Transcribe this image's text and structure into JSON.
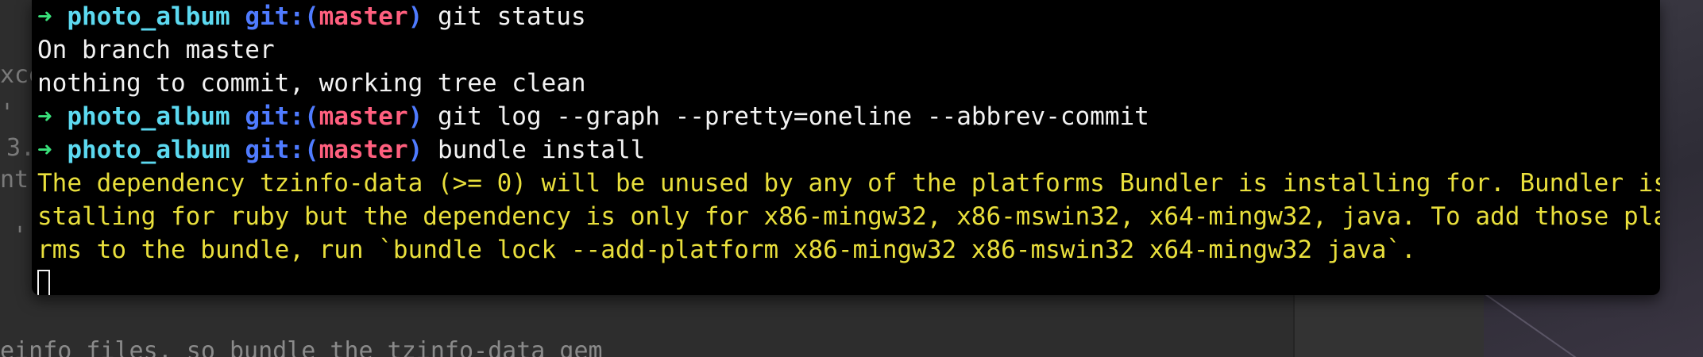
{
  "background": {
    "fragments": [
      "xce",
      "'",
      "3.",
      "nt",
      "'."
    ],
    "bottom_text": "einfo files, so bundle the tzinfo-data gem"
  },
  "terminal": {
    "prompt_arrow": "➜",
    "prompt_dir": "photo_album",
    "prompt_git_prefix": "git:(",
    "prompt_branch": "master",
    "prompt_git_suffix": ")",
    "lines": [
      {
        "type": "prompt",
        "command": "git status"
      },
      {
        "type": "output",
        "text": "On branch master"
      },
      {
        "type": "output",
        "text": "nothing to commit, working tree clean"
      },
      {
        "type": "prompt",
        "command": "git log --graph --pretty=oneline --abbrev-commit"
      },
      {
        "type": "prompt",
        "command": "bundle install"
      },
      {
        "type": "warning",
        "text": "The dependency tzinfo-data (>= 0) will be unused by any of the platforms Bundler is installing for. Bundler is in"
      },
      {
        "type": "warning",
        "text": "stalling for ruby but the dependency is only for x86-mingw32, x86-mswin32, x64-mingw32, java. To add those platfo"
      },
      {
        "type": "warning",
        "text": "rms to the bundle, run `bundle lock --add-platform x86-mingw32 x86-mswin32 x64-mingw32 java`."
      }
    ]
  },
  "colors": {
    "arrow": "#39e07a",
    "dir": "#5cd9f0",
    "git": "#4f7bff",
    "branch": "#ff5f7e",
    "warning": "#e9df3c",
    "text": "#f2f2f2"
  }
}
